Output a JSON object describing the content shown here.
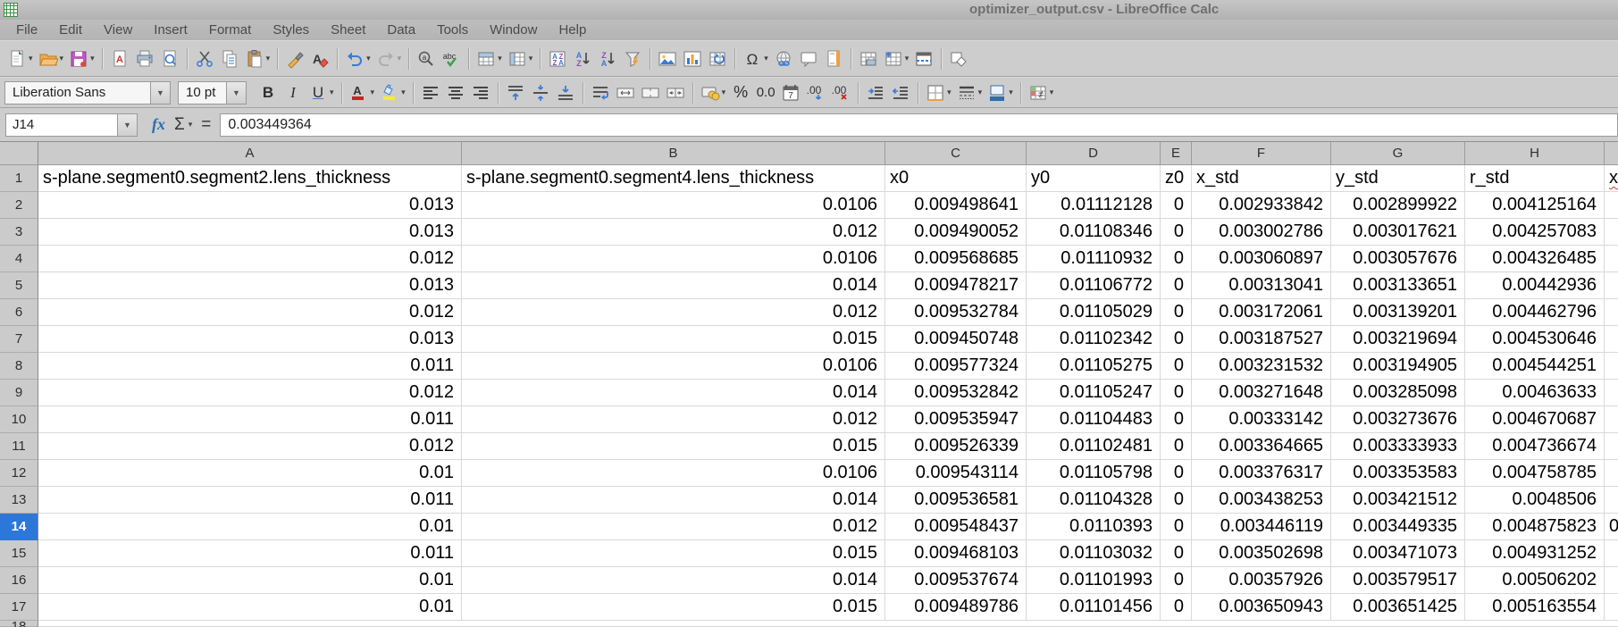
{
  "window": {
    "title": "optimizer_output.csv - LibreOffice Calc",
    "app_icon": "calc-app-icon"
  },
  "menu_bar": [
    "File",
    "Edit",
    "View",
    "Insert",
    "Format",
    "Styles",
    "Sheet",
    "Data",
    "Tools",
    "Window",
    "Help"
  ],
  "standard_toolbar": [
    {
      "name": "new-document",
      "dropdown": true
    },
    {
      "name": "open-file",
      "dropdown": true
    },
    {
      "name": "save",
      "dropdown": true
    },
    {
      "sep": true
    },
    {
      "name": "export-as-pdf"
    },
    {
      "name": "print"
    },
    {
      "name": "print-preview"
    },
    {
      "sep": true
    },
    {
      "name": "cut"
    },
    {
      "name": "copy"
    },
    {
      "name": "paste",
      "dropdown": true
    },
    {
      "sep": true
    },
    {
      "name": "clone-formatting"
    },
    {
      "name": "clear-formatting"
    },
    {
      "sep": true
    },
    {
      "name": "undo",
      "dropdown": true
    },
    {
      "name": "redo",
      "dropdown": true,
      "disabled": true
    },
    {
      "sep": true
    },
    {
      "name": "find-and-replace"
    },
    {
      "name": "spelling"
    },
    {
      "sep": true
    },
    {
      "name": "insert-rows",
      "dropdown": true
    },
    {
      "name": "insert-columns",
      "dropdown": true
    },
    {
      "sep": true
    },
    {
      "name": "sort"
    },
    {
      "name": "sort-ascending"
    },
    {
      "name": "sort-descending"
    },
    {
      "name": "autofilter"
    },
    {
      "sep": true
    },
    {
      "name": "insert-image"
    },
    {
      "name": "insert-chart"
    },
    {
      "name": "pivot-table"
    },
    {
      "sep": true
    },
    {
      "name": "special-character",
      "dropdown": true
    },
    {
      "name": "hyperlink"
    },
    {
      "name": "insert-comment"
    },
    {
      "name": "headers-and-footers"
    },
    {
      "sep": true
    },
    {
      "name": "define-print-area"
    },
    {
      "name": "freeze-rows-and-columns",
      "dropdown": true
    },
    {
      "name": "split-window"
    },
    {
      "sep": true
    },
    {
      "name": "show-draw-functions"
    }
  ],
  "formatting_toolbar": {
    "font_name": "Liberation Sans",
    "font_size": "10 pt",
    "buttons": [
      {
        "name": "bold"
      },
      {
        "name": "italic"
      },
      {
        "name": "underline",
        "dropdown": true
      },
      {
        "sep": true
      },
      {
        "name": "font-color",
        "dropdown": true
      },
      {
        "name": "highlighting-color",
        "dropdown": true
      },
      {
        "sep": true
      },
      {
        "name": "align-left"
      },
      {
        "name": "align-center"
      },
      {
        "name": "align-right"
      },
      {
        "sep": true
      },
      {
        "name": "align-top"
      },
      {
        "name": "center-vertically"
      },
      {
        "name": "align-bottom"
      },
      {
        "sep": true
      },
      {
        "name": "wrap-text"
      },
      {
        "name": "merge-and-center-cells"
      },
      {
        "name": "merge-cells"
      },
      {
        "name": "unmerge-cells"
      },
      {
        "sep": true
      },
      {
        "name": "format-as-currency",
        "dropdown": true
      },
      {
        "name": "format-as-percent"
      },
      {
        "name": "format-as-number"
      },
      {
        "name": "format-as-date"
      },
      {
        "name": "add-decimal-place"
      },
      {
        "name": "delete-decimal-place"
      },
      {
        "sep": true
      },
      {
        "name": "increase-indent"
      },
      {
        "name": "decrease-indent"
      },
      {
        "sep": true
      },
      {
        "name": "borders",
        "dropdown": true
      },
      {
        "name": "border-style",
        "dropdown": true
      },
      {
        "name": "border-color",
        "dropdown": true
      },
      {
        "sep": true
      },
      {
        "name": "conditional-formatting",
        "dropdown": true
      }
    ]
  },
  "formula_bar": {
    "cell_reference": "J14",
    "fx_label": "fx",
    "sum_label": "Σ",
    "equals_label": "=",
    "formula": "0.003449364"
  },
  "grid": {
    "column_headers": [
      "A",
      "B",
      "C",
      "D",
      "E",
      "F",
      "G",
      "H"
    ],
    "row_headers": [
      "1",
      "2",
      "3",
      "4",
      "5",
      "6",
      "7",
      "8",
      "9",
      "10",
      "11",
      "12",
      "13",
      "14",
      "15",
      "16",
      "17"
    ],
    "partial_bottom_row": "18",
    "selected_row": 14,
    "header_row": [
      "s-plane.segment0.segment2.lens_thickness",
      "s-plane.segment0.segment4.lens_thickness",
      "x0",
      "y0",
      "z0",
      "x_std",
      "y_std",
      "r_std"
    ],
    "overflow_column": {
      "row1_text": "x",
      "row14_text": "0",
      "spellcheck_underline": true
    },
    "data_rows": [
      [
        "0.013",
        "0.0106",
        "0.009498641",
        "0.01112128",
        "0",
        "0.002933842",
        "0.002899922",
        "0.004125164"
      ],
      [
        "0.013",
        "0.012",
        "0.009490052",
        "0.01108346",
        "0",
        "0.003002786",
        "0.003017621",
        "0.004257083"
      ],
      [
        "0.012",
        "0.0106",
        "0.009568685",
        "0.01110932",
        "0",
        "0.003060897",
        "0.003057676",
        "0.004326485"
      ],
      [
        "0.013",
        "0.014",
        "0.009478217",
        "0.01106772",
        "0",
        "0.00313041",
        "0.003133651",
        "0.00442936"
      ],
      [
        "0.012",
        "0.012",
        "0.009532784",
        "0.01105029",
        "0",
        "0.003172061",
        "0.003139201",
        "0.004462796"
      ],
      [
        "0.013",
        "0.015",
        "0.009450748",
        "0.01102342",
        "0",
        "0.003187527",
        "0.003219694",
        "0.004530646"
      ],
      [
        "0.011",
        "0.0106",
        "0.009577324",
        "0.01105275",
        "0",
        "0.003231532",
        "0.003194905",
        "0.004544251"
      ],
      [
        "0.012",
        "0.014",
        "0.009532842",
        "0.01105247",
        "0",
        "0.003271648",
        "0.003285098",
        "0.00463633"
      ],
      [
        "0.011",
        "0.012",
        "0.009535947",
        "0.01104483",
        "0",
        "0.00333142",
        "0.003273676",
        "0.004670687"
      ],
      [
        "0.012",
        "0.015",
        "0.009526339",
        "0.01102481",
        "0",
        "0.003364665",
        "0.003333933",
        "0.004736674"
      ],
      [
        "0.01",
        "0.0106",
        "0.009543114",
        "0.01105798",
        "0",
        "0.003376317",
        "0.003353583",
        "0.004758785"
      ],
      [
        "0.011",
        "0.014",
        "0.009536581",
        "0.01104328",
        "0",
        "0.003438253",
        "0.003421512",
        "0.0048506"
      ],
      [
        "0.01",
        "0.012",
        "0.009548437",
        "0.0110393",
        "0",
        "0.003446119",
        "0.003449335",
        "0.004875823"
      ],
      [
        "0.011",
        "0.015",
        "0.009468103",
        "0.01103032",
        "0",
        "0.003502698",
        "0.003471073",
        "0.004931252"
      ],
      [
        "0.01",
        "0.014",
        "0.009537674",
        "0.01101993",
        "0",
        "0.00357926",
        "0.003579517",
        "0.00506202"
      ],
      [
        "0.01",
        "0.015",
        "0.009489786",
        "0.01101456",
        "0",
        "0.003650943",
        "0.003651425",
        "0.005163554"
      ]
    ]
  }
}
